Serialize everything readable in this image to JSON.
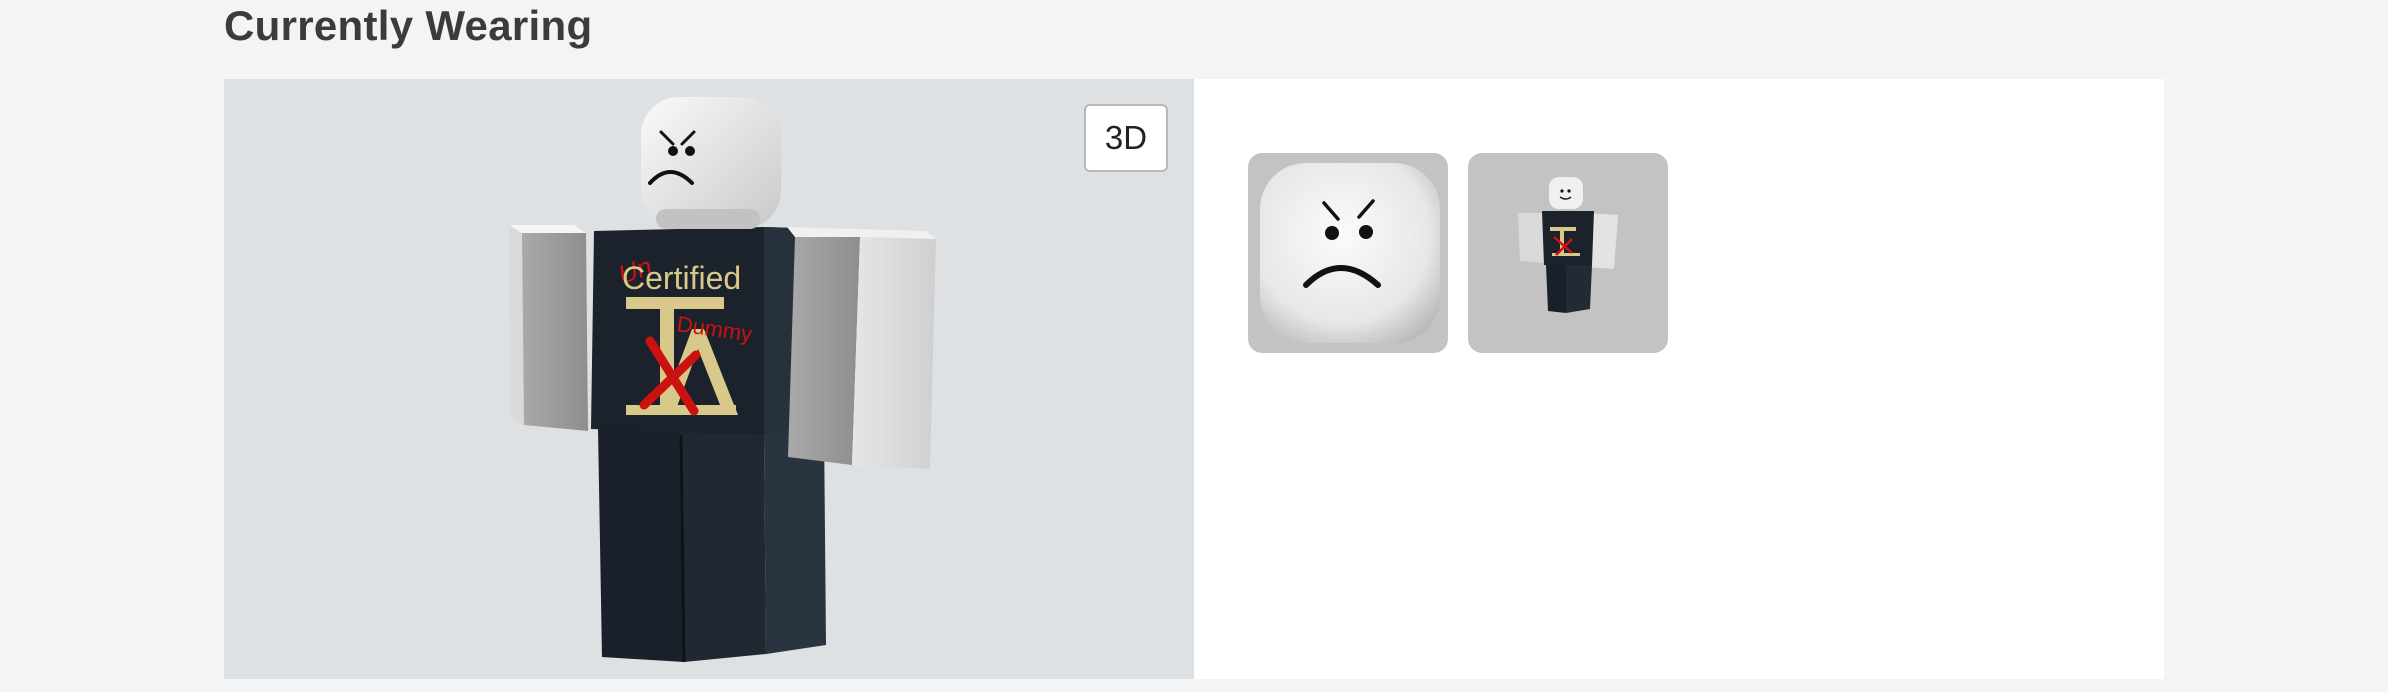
{
  "section": {
    "title": "Currently Wearing"
  },
  "viewer": {
    "mode_button_label": "3D"
  },
  "outfit": {
    "shirt_text": {
      "top": "Certified",
      "middle": "Dummy",
      "scribble": "Un"
    },
    "colors": {
      "viewer_bg": "#dee1e3",
      "skin": "#e8e8e6",
      "shirt": "#1b222b",
      "logo": "#d8c98a",
      "marker": "#cc1111"
    }
  },
  "items": [
    {
      "name": "Angry face",
      "icon": "angry-face-icon"
    },
    {
      "name": "Avatar outfit",
      "icon": "avatar-outfit-icon"
    }
  ]
}
